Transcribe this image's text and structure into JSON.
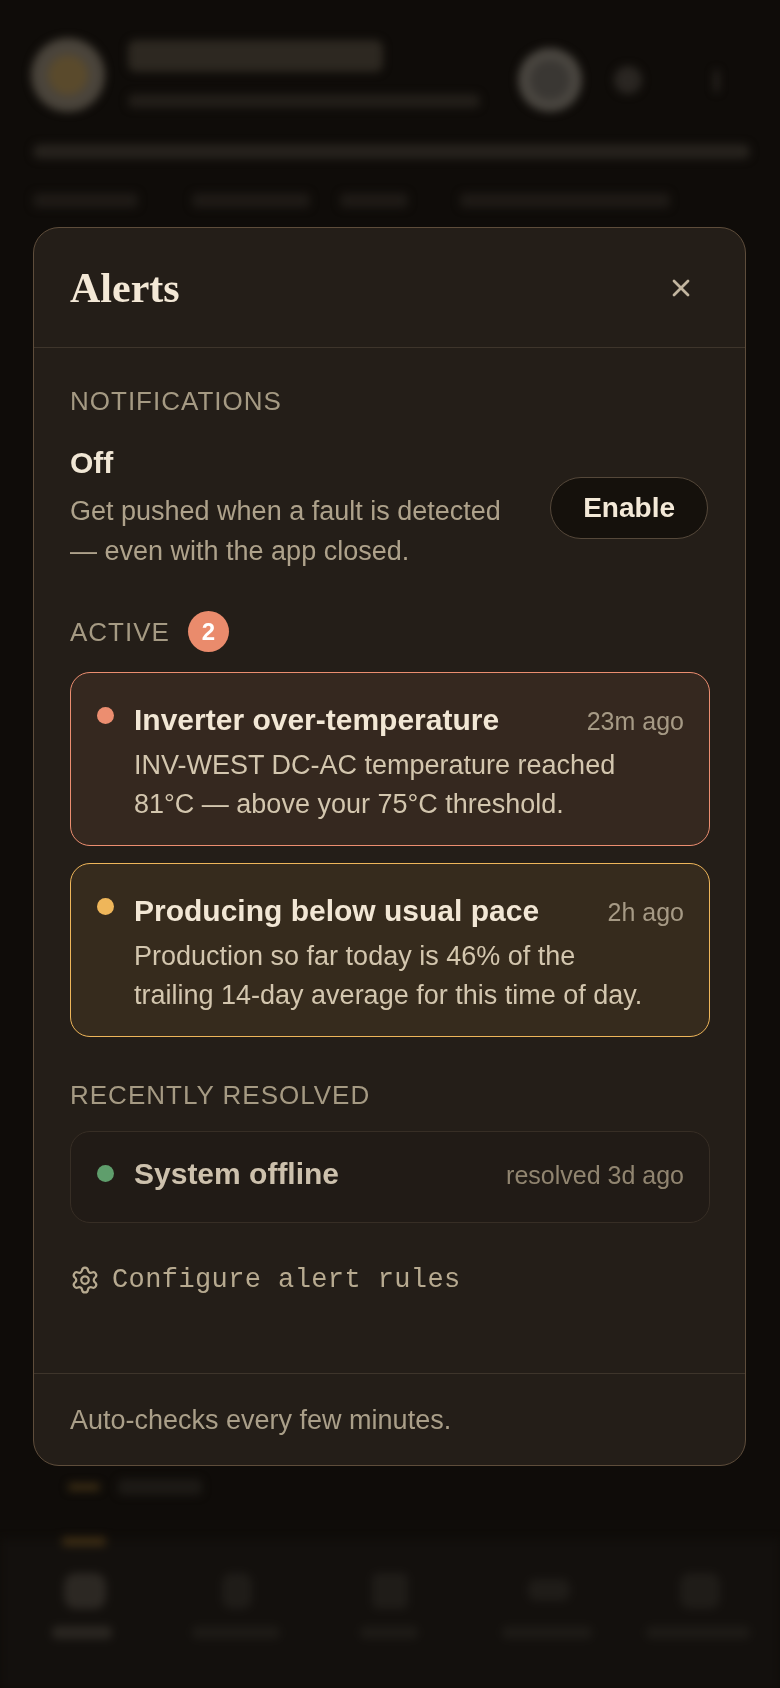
{
  "dialog": {
    "title": "Alerts"
  },
  "notifications": {
    "heading": "NOTIFICATIONS",
    "status": "Off",
    "description": "Get pushed when a fault is detected — even with the app closed.",
    "button": "Enable"
  },
  "active": {
    "heading": "ACTIVE",
    "count": "2",
    "alerts": [
      {
        "title": "Inverter over-temperature",
        "time": "23m ago",
        "message": "INV-WEST DC-AC temperature reached 81°C — above your 75°C threshold.",
        "color": "#ec8e70"
      },
      {
        "title": "Producing below usual pace",
        "time": "2h ago",
        "message": "Production so far today is 46% of the trailing 14-day average for this time of day.",
        "color": "#efb65a"
      }
    ]
  },
  "resolved": {
    "heading": "RECENTLY RESOLVED",
    "alerts": [
      {
        "title": "System offline",
        "time": "resolved 3d ago",
        "color": "#5f9e6c"
      }
    ]
  },
  "configure_link": "Configure alert rules",
  "footer": "Auto-checks every few minutes."
}
